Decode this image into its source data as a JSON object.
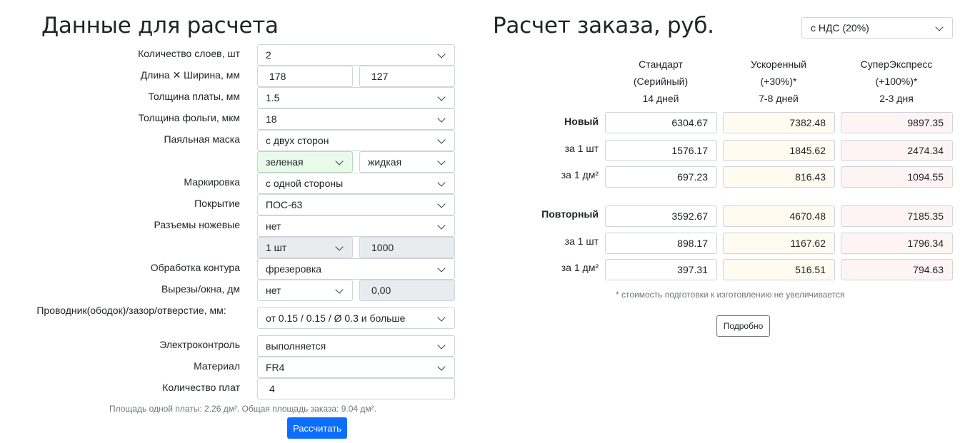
{
  "left": {
    "title": "Данные для расчета",
    "layers": {
      "label": "Количество слоев, шт",
      "value": "2"
    },
    "dims": {
      "label": "Длина ✕ Ширина, мм",
      "length": "178",
      "width": "127"
    },
    "thickness": {
      "label": "Толщина платы, мм",
      "value": "1.5"
    },
    "foil": {
      "label": "Толщина фольги, мкм",
      "value": "18"
    },
    "mask": {
      "label": "Паяльная маска",
      "value": "с двух сторон",
      "color": "зеленая",
      "type": "жидкая"
    },
    "marking": {
      "label": "Маркировка",
      "value": "с одной стороны"
    },
    "coating": {
      "label": "Покрытие",
      "value": "ПОС-63"
    },
    "connectors": {
      "label": "Разъемы ножевые",
      "value": "нет",
      "qty": "1 шт",
      "qty_value": "1000"
    },
    "contour": {
      "label": "Обработка контура",
      "value": "фрезеровка"
    },
    "cutouts": {
      "label": "Вырезы/окна, дм",
      "value": "нет",
      "amount": "0,00"
    },
    "conductor": {
      "label": "Проводник(ободок)/зазор/отверстие, мм:",
      "value": "от 0.15 / 0.15 / Ø 0.3 и больше"
    },
    "etest": {
      "label": "Электроконтроль",
      "value": "выполняется"
    },
    "material": {
      "label": "Материал",
      "value": "FR4"
    },
    "boards": {
      "label": "Количество плат",
      "value": "4"
    },
    "area_note": "Площадь одной платы: 2.26 дм². Общая площадь заказа: 9.04 дм².",
    "calc_button": "Рассчитать"
  },
  "right": {
    "title": "Расчет заказа, руб.",
    "vat_select": "с НДС (20%)",
    "columns": [
      {
        "line1": "Стандарт",
        "line2": "(Серийный)",
        "line3": "14 дней"
      },
      {
        "line1": "Ускоренный",
        "line2": "(+30%)*",
        "line3": "7-8 дней"
      },
      {
        "line1": "СуперЭкспресс",
        "line2": "(+100%)*",
        "line3": "2-3 дня"
      }
    ],
    "rows": [
      {
        "label": "Новый",
        "values": [
          "6304.67",
          "7382.48",
          "9897.35"
        ]
      },
      {
        "label": "за 1 шт",
        "values": [
          "1576.17",
          "1845.62",
          "2474.34"
        ]
      },
      {
        "label": "за 1 дм²",
        "values": [
          "697.23",
          "816.43",
          "1094.55"
        ]
      },
      {
        "label": "Повторный",
        "values": [
          "3592.67",
          "4670.48",
          "7185.35"
        ]
      },
      {
        "label": "за 1 шт",
        "values": [
          "898.17",
          "1167.62",
          "1796.34"
        ]
      },
      {
        "label": "за 1 дм²",
        "values": [
          "397.31",
          "516.51",
          "794.63"
        ]
      }
    ],
    "footnote": "* стоимость подготовки к изготовлению не увеличивается",
    "details_button": "Подробно"
  },
  "colors": {
    "primary": "#0d6efd",
    "green_select": "#eafaea",
    "accelerated_cell": "#fffbf0",
    "super_cell": "#fff4f4"
  }
}
